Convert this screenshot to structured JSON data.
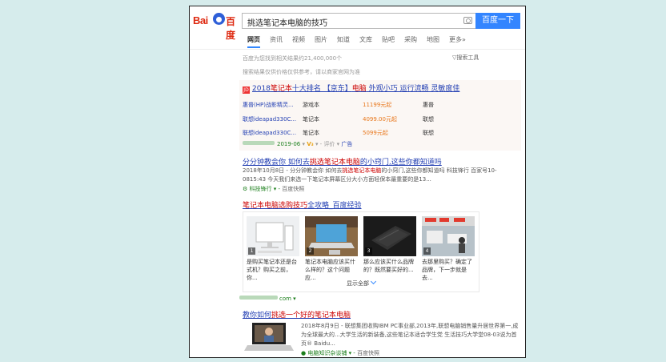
{
  "logo": {
    "text_left": "Bai",
    "text_right": "百度"
  },
  "search": {
    "query": "挑选笔记本电脑的技巧",
    "button": "百度一下"
  },
  "tabs": [
    "网页",
    "资讯",
    "视频",
    "图片",
    "知道",
    "文库",
    "贴吧",
    "采购",
    "地图",
    "更多»"
  ],
  "meta": {
    "count": "百度为您找到相关结果约21,400,000个",
    "tools": "搜索工具",
    "note": "搜索结果仅供价格仅供参考，请以商家官网为准"
  },
  "ad": {
    "badge": "JD",
    "title_pre": "2018",
    "title_em": "笔记本",
    "title_mid": "十大排名 【京东】",
    "title_em2": "电脑",
    "title_post": " 外观小巧 运行流畅 灵敏度佳",
    "rows": [
      {
        "name": "惠普(HP)战影精灵...",
        "type": "游戏本",
        "price": "11199元起",
        "brand": "惠普"
      },
      {
        "name": "联想ideapad330C...",
        "type": "笔记本",
        "price": "4099.00元起",
        "brand": "联想"
      },
      {
        "name": "联想ideapad330C...",
        "type": "笔记本",
        "price": "5099元起",
        "brand": "联想"
      }
    ],
    "footer_date": "2019-06",
    "footer_v": "V₃",
    "footer_review": "评价",
    "footer_ad": "广告"
  },
  "result1": {
    "title_pre": "分分钟教会你 如何去",
    "title_em": "挑选笔记本电脑",
    "title_post": "的小窍门,这些你都知道吗",
    "body_date": "2018年10月8日 - 分分钟教会你 如何去",
    "body_em": "挑选笔记本电脑",
    "body_rest": "的小窍门,这些你都知道吗 科技锋行 百家号10-0815:43 今天我们来选一下笔记本屏幕区分大小方面轻保本最重要的是13...",
    "source": "科技锋行",
    "snapshot": "百度快照"
  },
  "result2": {
    "title_em": "笔记本电脑选购技巧",
    "title_post": "全攻略_百度经验",
    "items": [
      {
        "num": "1",
        "caption": "是购买笔记本还是台式机？购买之前，你..."
      },
      {
        "num": "2",
        "caption": "笔记本电脑应该买什么样的？这个问题应..."
      },
      {
        "num": "3",
        "caption": "那么应该买什么品牌的？既然要买好的..."
      },
      {
        "num": "4",
        "caption": "去那里购买？确定了品牌，下一步就是去..."
      }
    ],
    "show_all": "显示全部",
    "domain_suffix": "com"
  },
  "result3": {
    "title_pre": "教你如何",
    "title_em": "挑选一个好的笔记本电脑",
    "body": "2018年8月9日 - 联想集团收购IBM PC事业部,2013年,联想电脑销售量升居世界第一,成为全球最大的...大学生活的新装备,这些笔记本适合学生党 生活技巧大学堂08-03说为首页® Baidu...",
    "source": "电脑知识杂谈铺",
    "snapshot": "百度快照"
  }
}
